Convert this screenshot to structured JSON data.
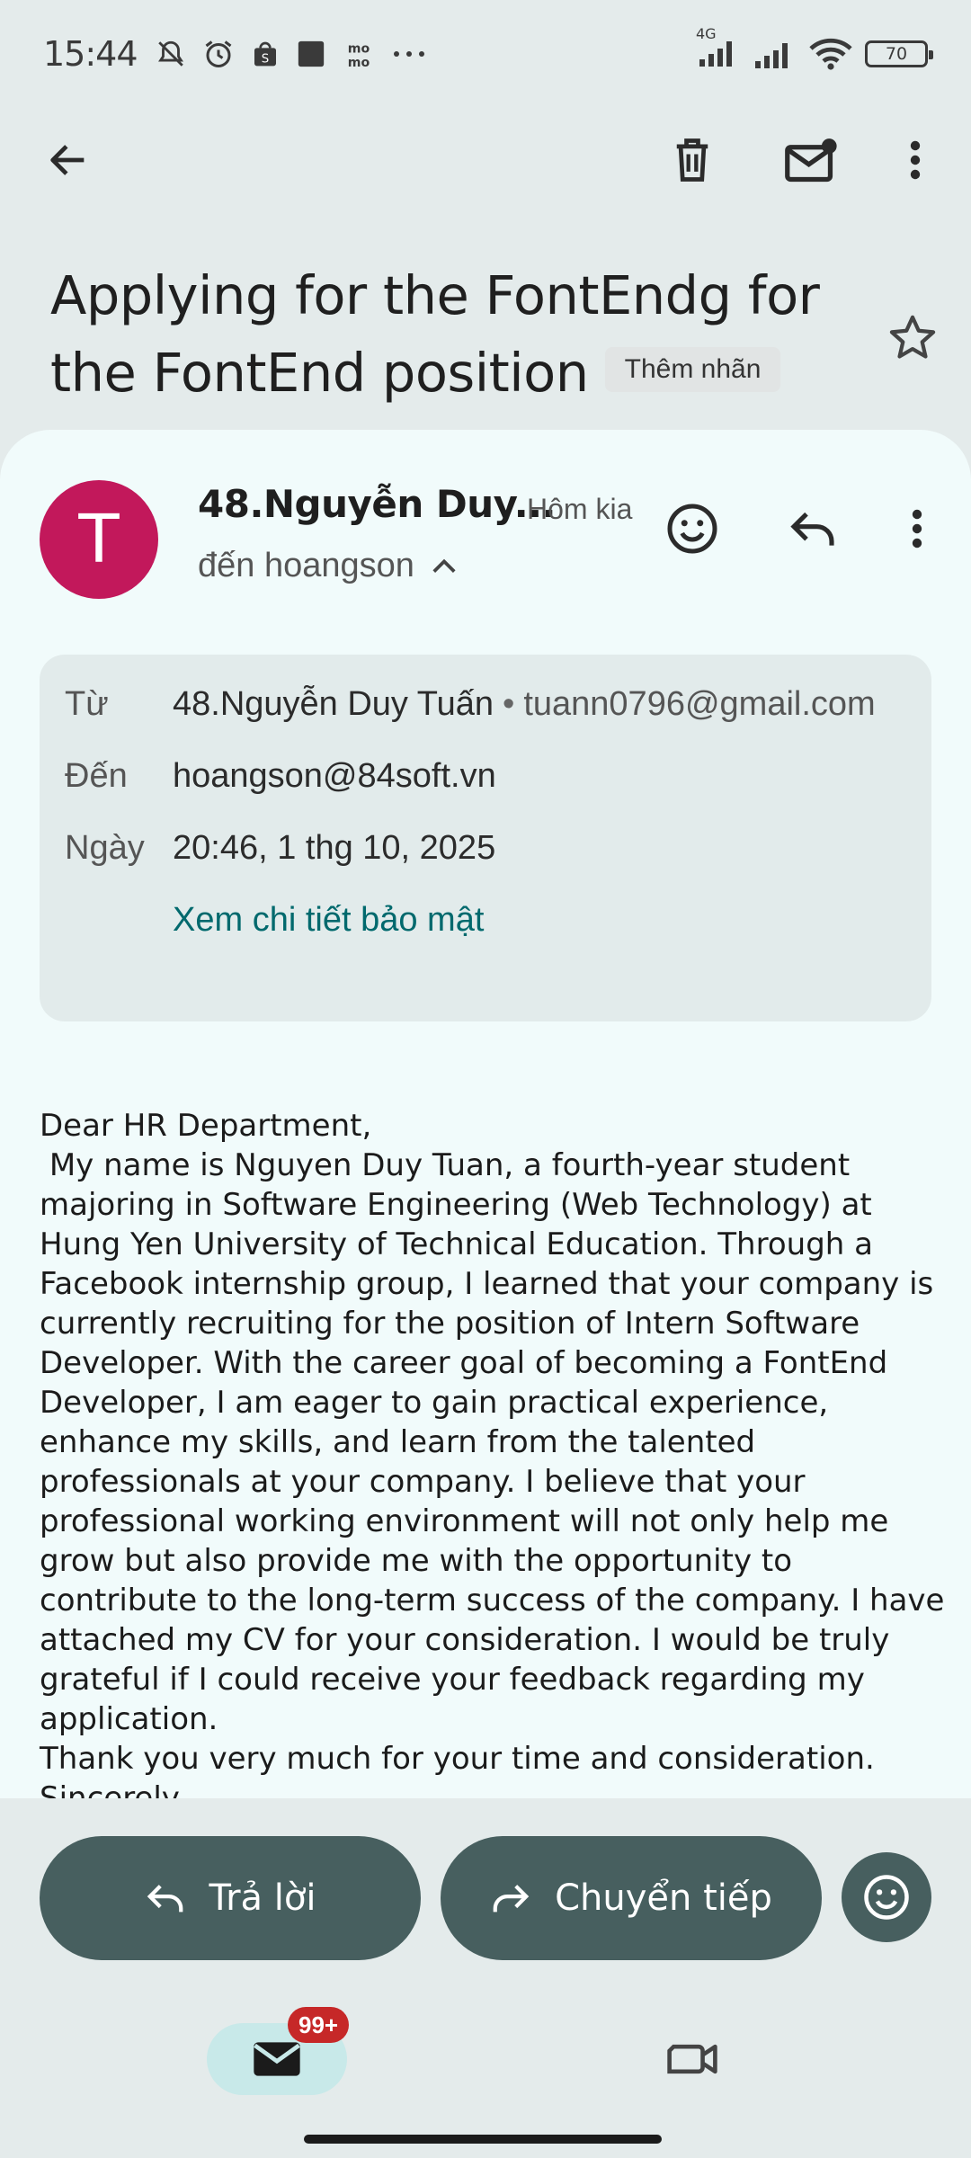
{
  "status_bar": {
    "time": "15:44",
    "network": "4G",
    "battery": "70",
    "icons": [
      "mute-icon",
      "alarm-icon",
      "shopee-icon",
      "app-icon",
      "momo-icon",
      "more-dots"
    ]
  },
  "toolbar": {
    "back": "back-arrow-icon",
    "delete": "trash-icon",
    "mark_unread": "mail-unread-icon",
    "more": "more-vert-icon"
  },
  "subject": {
    "text": "Applying for the FontEndg for the FontEnd position",
    "label_chip": "Thêm nhãn"
  },
  "message": {
    "avatar_letter": "T",
    "avatar_color": "#c2185b",
    "sender": "48.Nguyễn Duy...",
    "time": "Hôm kia",
    "recipient": "đến hoangson"
  },
  "details": {
    "from_label": "Từ",
    "from_name": "48.Nguyễn Duy Tuấn",
    "separator": "•",
    "from_email": "tuann0796@gmail.com",
    "to_label": "Đến",
    "to_value": "hoangson@84soft.vn",
    "date_label": "Ngày",
    "date_value": "20:46, 1 thg 10, 2025",
    "security_link": "Xem chi tiết bảo mật"
  },
  "body": "Dear HR Department,\n My name is Nguyen Duy Tuan, a fourth-year student majoring in Software Engineering (Web Technology) at Hung Yen University of Technical Education. Through a Facebook internship group, I learned that your company is currently recruiting for the position of Intern Software Developer. With the career goal of becoming a FontEnd Developer, I am eager to gain practical experience, enhance my skills, and learn from the talented professionals at your company. I believe that your professional working environment will not only help me grow but also provide me with the opportunity to contribute to the long-term success of the company. I have attached my CV for your consideration. I would be truly grateful if I could receive your feedback regarding my application.\nThank you very much for your time and consideration.\nSincerely,\n Nguyen Duy Tuan",
  "actions": {
    "reply": "Trả lời",
    "forward": "Chuyển tiếp"
  },
  "nav": {
    "mail_badge": "99+"
  },
  "colors": {
    "accent": "#00696d",
    "action_button": "#475f5f",
    "badge": "#c62828"
  }
}
